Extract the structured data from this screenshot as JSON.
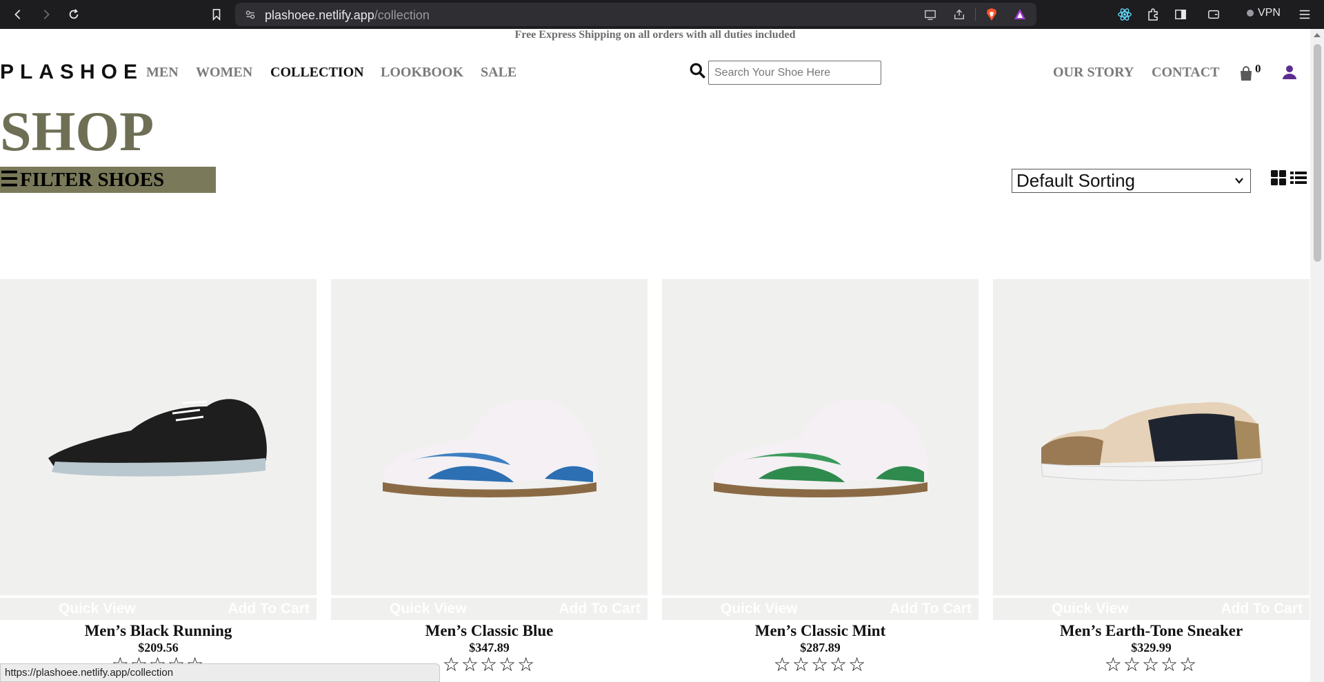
{
  "browser": {
    "url_host": "plashoee.netlify.app",
    "url_path": "/collection",
    "vpn_label": "VPN",
    "icons": [
      "back-icon",
      "forward-icon",
      "reload-icon",
      "bookmark-icon",
      "site-info-icon",
      "cast-icon",
      "share-icon",
      "brave-shield-icon",
      "brave-rewards-icon",
      "react-devtools-icon",
      "extensions-icon",
      "sidebar-icon",
      "wallet-icon",
      "menu-icon"
    ]
  },
  "promo": "Free Express Shipping on all orders with all duties included",
  "header": {
    "logo": "PLASHOE",
    "nav_left": [
      "MEN",
      "WOMEN",
      "COLLECTION",
      "LOOKBOOK",
      "SALE"
    ],
    "active_nav": "COLLECTION",
    "search_placeholder": "Search Your Shoe Here",
    "nav_right": [
      "OUR STORY",
      "CONTACT"
    ],
    "cart_count": "0",
    "accent_color": "#5c2d91"
  },
  "shop": {
    "title": "SHOP",
    "filter_label": "FILTER SHOES",
    "sort_value": "Default Sorting",
    "title_color": "#6f6f55",
    "filter_bg": "#7a7a5a"
  },
  "products": [
    {
      "name": "Men’s Black Running",
      "price": "$209.56",
      "rating": 0,
      "quick_view": "Quick View",
      "add_to_cart": "Add To Cart"
    },
    {
      "name": "Men’s Classic Blue",
      "price": "$347.89",
      "rating": 0,
      "quick_view": "Quick View",
      "add_to_cart": "Add To Cart"
    },
    {
      "name": "Men’s Classic Mint",
      "price": "$287.89",
      "rating": 0,
      "quick_view": "Quick View",
      "add_to_cart": "Add To Cart"
    },
    {
      "name": "Men’s Earth-Tone Sneaker",
      "price": "$329.99",
      "rating": 0,
      "quick_view": "Quick View",
      "add_to_cart": "Add To Cart"
    }
  ],
  "status_url": "https://plashoee.netlify.app/collection"
}
